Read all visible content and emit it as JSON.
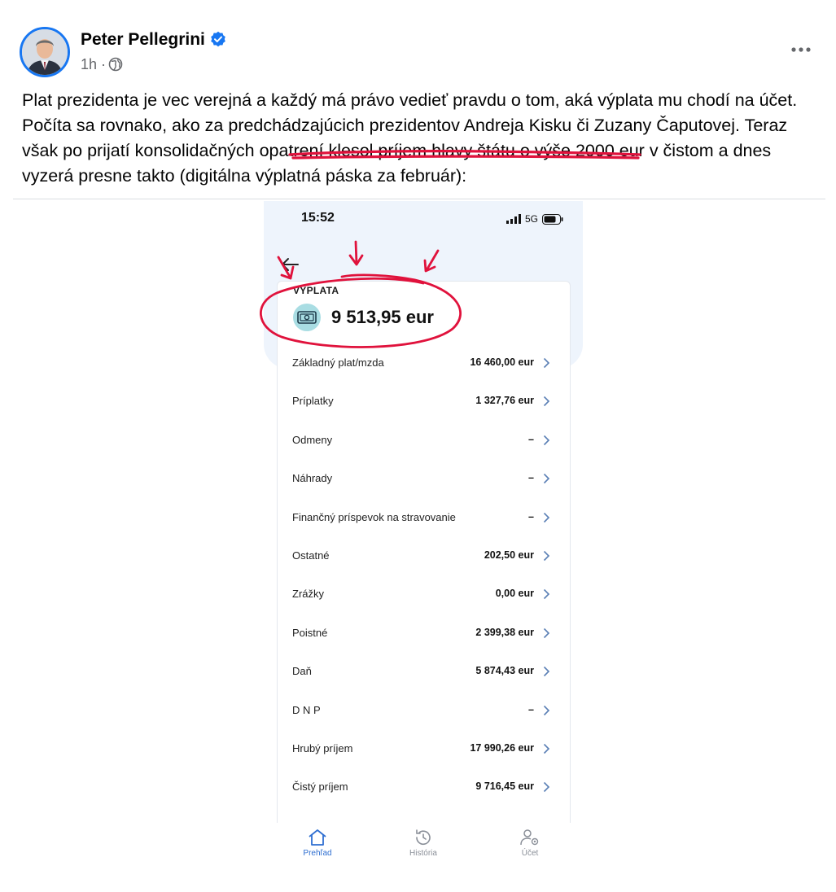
{
  "post": {
    "author": "Peter Pellegrini",
    "time": "1h",
    "separator": "·",
    "text": "Plat prezidenta je vec verejná a každý má právo vedieť pravdu o tom, aká výplata mu chodí na účet. Počíta sa rovnako, ako za predchádzajúcich prezidentov Andreja Kisku či Zuzany Čaputovej. Teraz však po prijatí konsolidačných opatrení klesol príjem hlavy štátu o výše 2000 eur v čistom a dnes vyzerá presne takto (digitálna výplatná páska za február):"
  },
  "colors": {
    "verified": "#1877f2",
    "annotation": "#e0123c",
    "accent": "#2f6fd1"
  },
  "phone": {
    "status_time": "15:52",
    "network": "5G",
    "card_label": "VÝPLATA",
    "amount": "9 513,95 eur",
    "rows": [
      {
        "label": "Základný plat/mzda",
        "value": "16 460,00 eur"
      },
      {
        "label": "Príplatky",
        "value": "1 327,76 eur"
      },
      {
        "label": "Odmeny",
        "value": "–"
      },
      {
        "label": "Náhrady",
        "value": "–"
      },
      {
        "label": "Finančný príspevok na stravovanie",
        "value": "–"
      },
      {
        "label": "Ostatné",
        "value": "202,50 eur"
      },
      {
        "label": "Zrážky",
        "value": "0,00 eur"
      },
      {
        "label": "Poistné",
        "value": "2 399,38 eur"
      },
      {
        "label": "Daň",
        "value": "5 874,43 eur"
      },
      {
        "label": "D N P",
        "value": "–"
      },
      {
        "label": "Hrubý príjem",
        "value": "17 990,26 eur"
      },
      {
        "label": "Čistý príjem",
        "value": "9 716,45 eur"
      }
    ],
    "tabs": [
      {
        "label": "Prehľad",
        "icon": "home-icon",
        "active": true
      },
      {
        "label": "História",
        "icon": "history-icon",
        "active": false
      },
      {
        "label": "Účet",
        "icon": "account-icon",
        "active": false
      }
    ]
  }
}
